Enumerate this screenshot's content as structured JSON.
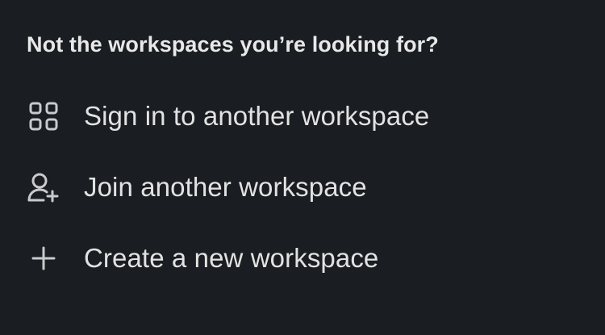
{
  "header": {
    "title": "Not the workspaces you’re looking for?"
  },
  "options": [
    {
      "label": "Sign in to another workspace",
      "icon": "grid-icon"
    },
    {
      "label": "Join another workspace",
      "icon": "user-add-icon"
    },
    {
      "label": "Create a new workspace",
      "icon": "plus-icon"
    }
  ],
  "colors": {
    "background": "#1a1d21",
    "text": "#e2e2e2",
    "icon": "#c9cacc"
  }
}
